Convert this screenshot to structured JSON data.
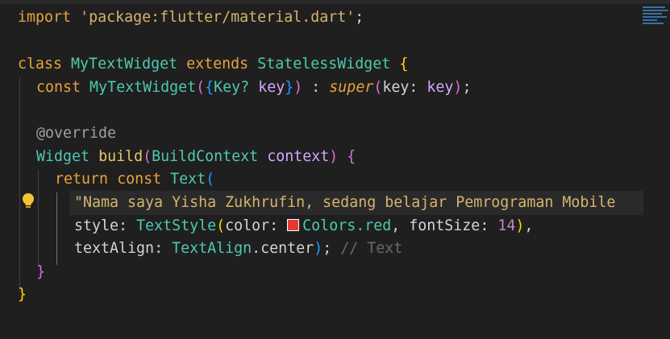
{
  "editor": {
    "file_lines": {
      "l1": {
        "kw_import": "import",
        "str_pkg": "'package:flutter/material.dart'",
        "semi": ";"
      },
      "l3": {
        "kw_class": "class",
        "class_name": "MyTextWidget",
        "kw_extends": "extends",
        "parent": "StatelessWidget",
        "brace": "{"
      },
      "l4": {
        "kw_const": "const",
        "ctor": "MyTextWidget",
        "open": "(",
        "brace_open": "{",
        "key_type": "Key?",
        "key_name": "key",
        "brace_close": "}",
        "close": ")",
        "colon": " : ",
        "super": "super",
        "p_open": "(",
        "arg_name": "key",
        "arg_colon": ": ",
        "arg_val": "key",
        "p_close": ")",
        "semi": ";"
      },
      "l6": {
        "annotation": "@override"
      },
      "l7": {
        "ret_type": "Widget",
        "method": "build",
        "open": "(",
        "param_type": "BuildContext",
        "param_name": "context",
        "close": ")",
        "brace": "{"
      },
      "l8": {
        "kw_return": "return",
        "kw_const": "const",
        "widget": "Text",
        "open": "("
      },
      "l9": {
        "string": "\"Nama saya Yisha Zukhrufin, sedang belajar Pemrograman Mobile"
      },
      "l10": {
        "prop": "style",
        "colon": ": ",
        "type": "TextStyle",
        "open": "(",
        "color_prop": "color",
        "color_colon": ": ",
        "color_val": "Colors.red",
        "comma": ", ",
        "size_prop": "fontSize",
        "size_colon": ": ",
        "size_val": "14",
        "close": ")",
        "trail": ","
      },
      "l11": {
        "prop": "textAlign",
        "colon": ": ",
        "type": "TextAlign",
        "member": ".center",
        "close": ")",
        "semi": ";",
        "comment": "// Text"
      },
      "l12": {
        "brace": "}"
      },
      "l13": {
        "brace": "}"
      }
    },
    "swatch_color": "#e53935",
    "lightbulb_icon": "lightbulb-icon"
  }
}
